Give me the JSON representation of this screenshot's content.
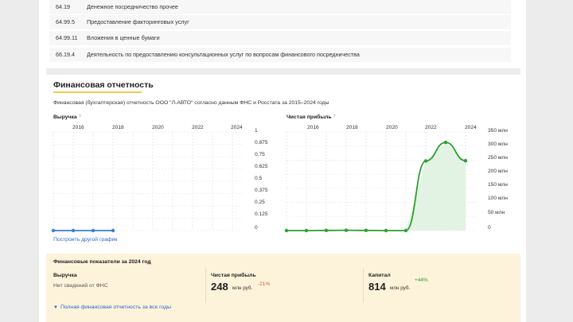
{
  "okved": [
    {
      "code": "64.19",
      "text": "Денежное посредничество прочее"
    },
    {
      "code": "64.99.5",
      "text": "Предоставление факторинговых услуг"
    },
    {
      "code": "64.99.11",
      "text": "Вложения в ценные бумаги"
    },
    {
      "code": "66.19.4",
      "text": "Деятельность по предоставлению консультационных услуг по вопросам финансового посредничества"
    }
  ],
  "financial": {
    "title": "Финансовая отчетность",
    "subtitle": "Финансовая (бухгалтерская) отчетность ООО \"Л-АВТО\" согласно данным ФНС и Росстата за 2015–2024 годы",
    "help_mark": "?",
    "other_chart_link": "Построить другой график"
  },
  "chart_data": [
    {
      "type": "line",
      "title": "Выручка",
      "x_ticks": [
        "2016",
        "2018",
        "2020",
        "2022",
        "2024"
      ],
      "y_ticks": [
        "1",
        "0.875",
        "0.75",
        "0.625",
        "0.5",
        "0.375",
        "0.25",
        "0.125",
        "0"
      ],
      "ylim": [
        0,
        1
      ],
      "x": [
        2015,
        2016,
        2017,
        2018
      ],
      "series": [
        {
          "values": [
            0,
            0,
            0,
            0
          ],
          "color": "#3b7ddd"
        }
      ],
      "grid": true
    },
    {
      "type": "area",
      "title": "Чистая прибыль",
      "x_ticks": [
        "2016",
        "2018",
        "2020",
        "2022",
        "2024"
      ],
      "y_ticks": [
        "350 млн",
        "300 млн",
        "250 млн",
        "200 млн",
        "150 млн",
        "100 млн",
        "50 млн",
        "0"
      ],
      "ylim": [
        0,
        350
      ],
      "x": [
        2015,
        2016,
        2017,
        2018,
        2019,
        2020,
        2021,
        2022,
        2023,
        2024
      ],
      "series": [
        {
          "values": [
            0,
            0,
            0.5,
            1,
            0.5,
            0,
            0,
            247,
            313,
            248
          ],
          "color": "#2e9e2e"
        }
      ],
      "grid": true
    }
  ],
  "summary": {
    "title": "Финансовые показатели за 2024 год",
    "chevron": "⌄",
    "revenue_label": "Выручка",
    "revenue_value": "Нет сведений от ФНС",
    "profit_label": "Чистая прибыль",
    "profit_value": "248",
    "profit_unit": "млн руб.",
    "profit_change": "-21%",
    "capital_label": "Капитал",
    "capital_value": "814",
    "capital_unit": "млн руб.",
    "capital_change": "+44%",
    "full_link": "Полная финансовая отчетность за все годы",
    "colors": {
      "negative": "#d9534f",
      "positive": "#2e9e2e",
      "link": "#2a64d1"
    }
  }
}
